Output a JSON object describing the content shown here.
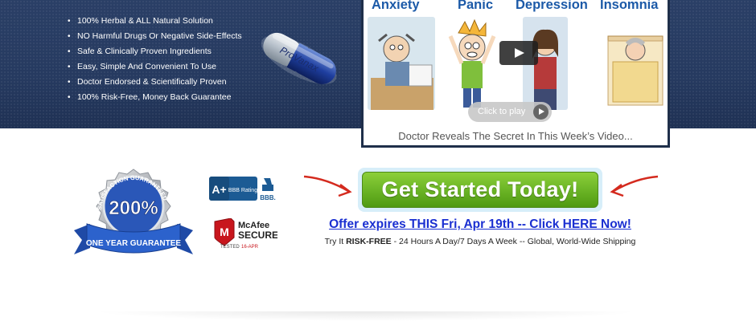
{
  "hero": {
    "bullets": [
      "100% Herbal & ALL Natural Solution",
      "NO Harmful Drugs Or Negative Side-Effects",
      "Safe & Clinically Proven Ingredients",
      "Easy, Simple And Convenient To Use",
      "Doctor Endorsed & Scientifically Proven",
      "100% Risk-Free, Money Back Guarantee"
    ],
    "pill_label": "ProVanax"
  },
  "video": {
    "titles": [
      "Anxiety",
      "Panic",
      "Depression",
      "Insomnia"
    ],
    "click_to_play": "Click to play",
    "caption": "Doctor Reveals The Secret In This Week’s Video..."
  },
  "badges": {
    "seal_top": "SATISFACTION GUARANTEED",
    "seal_number": "200%",
    "seal_ribbon": "ONE YEAR GUARANTEE",
    "bbb_grade": "A+",
    "bbb_text": "BBB Rating",
    "bbb_logo": "BBB.",
    "mcafee_name": "McAfee",
    "mcafee_secure": "SECURE",
    "mcafee_tested": "TESTED",
    "mcafee_date": "16-APR"
  },
  "cta": {
    "button_label": "Get Started Today!",
    "offer_link": "Offer expires THIS Fri, Apr 19th -- Click HERE Now!",
    "try_prefix": "Try It ",
    "try_bold": "RISK-FREE",
    "try_suffix": " - 24 Hours A Day/7 Days A Week -- Global, World-Wide Shipping"
  },
  "colors": {
    "hero_bg": "#263a60",
    "cta_green": "#6cb526",
    "link_blue": "#1a2fd1",
    "arrow_red": "#d42a1e",
    "video_title_blue": "#1c5aa8"
  }
}
